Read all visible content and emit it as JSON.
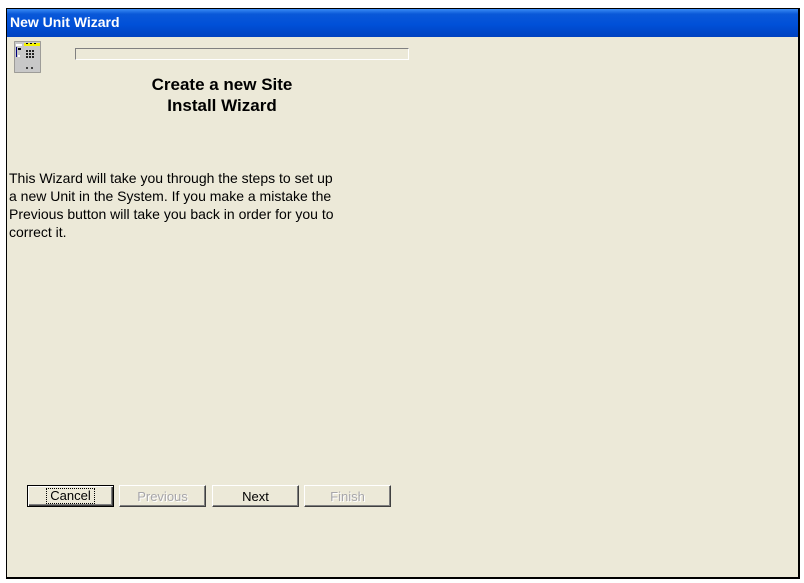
{
  "window": {
    "title": "New Unit Wizard",
    "icon": "wizard-unit-icon"
  },
  "wizard": {
    "progress_text": "",
    "heading_line1": "Create a new Site",
    "heading_line2": "Install  Wizard",
    "intro": "This Wizard will take you through the steps to set up\na new Unit in the System.  If you make a mistake the\nPrevious button will take you back in order for you to\ncorrect it."
  },
  "buttons": {
    "cancel": "Cancel",
    "previous": "Previous",
    "next": "Next",
    "finish": "Finish"
  },
  "colors": {
    "titlebar": "#0050d8",
    "dialog_bg": "#ece9d8",
    "disabled_text": "#a7a6aa"
  }
}
